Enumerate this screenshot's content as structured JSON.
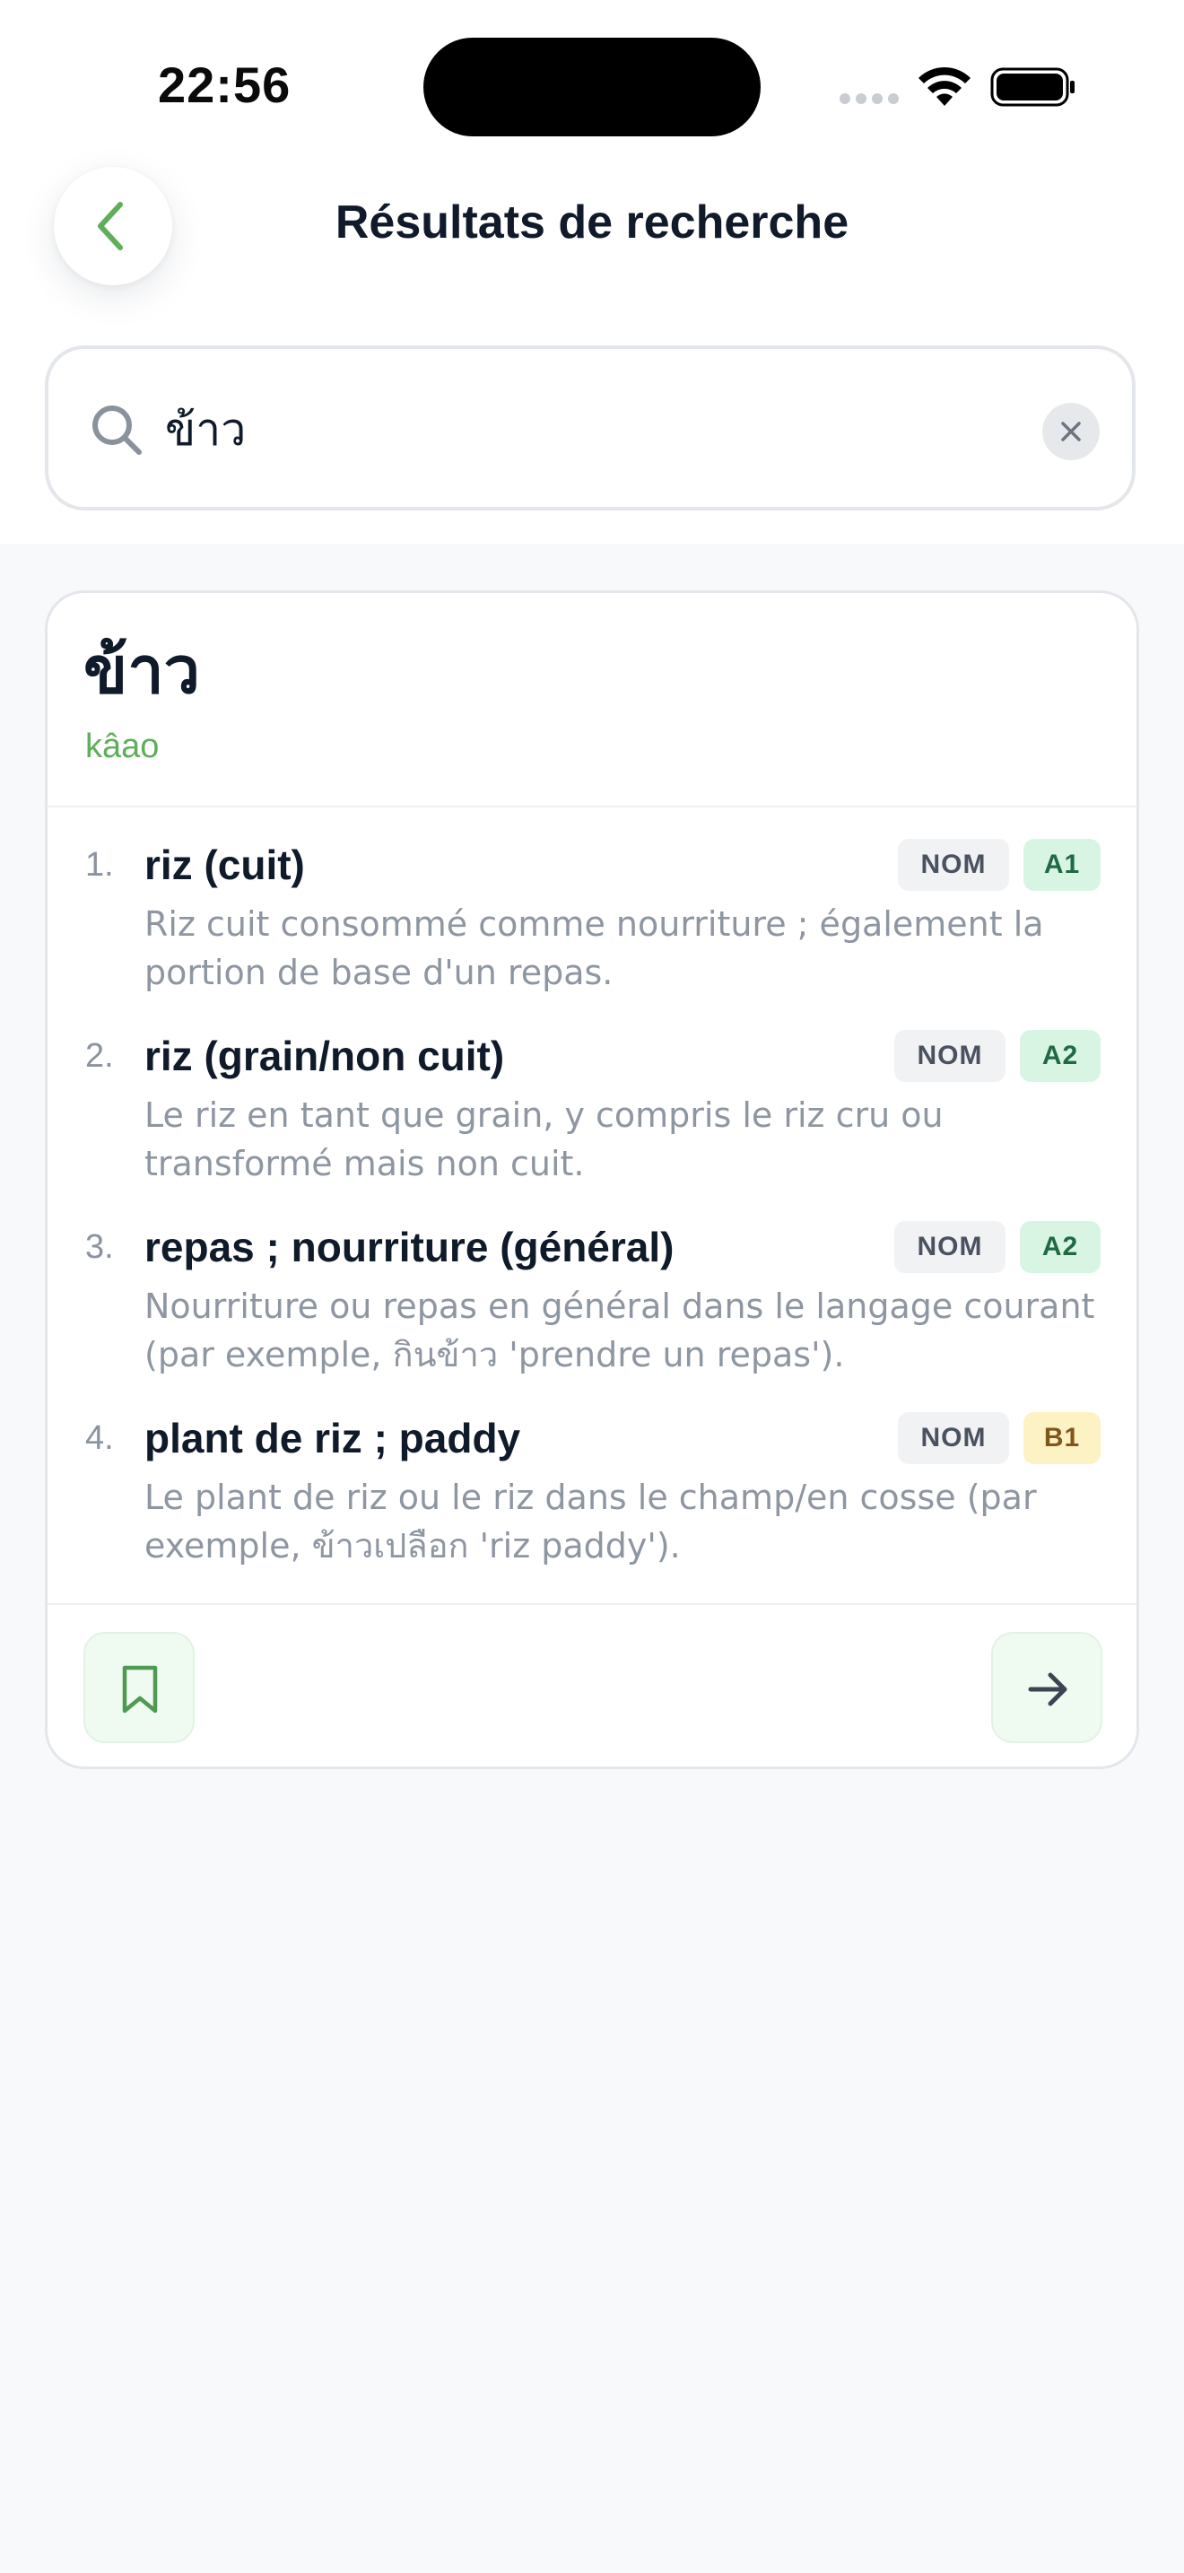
{
  "status_bar": {
    "time": "22:56"
  },
  "header": {
    "title": "Résultats de recherche"
  },
  "search": {
    "value": "ข้าว",
    "placeholder": ""
  },
  "entry": {
    "headword": "ข้าว",
    "romanization": "kâao",
    "senses": [
      {
        "number": "1.",
        "title": "riz (cuit)",
        "pos": "NOM",
        "level": "A1",
        "definition": "Riz cuit consommé comme nourriture ; également la portion de base d'un repas."
      },
      {
        "number": "2.",
        "title": "riz (grain/non cuit)",
        "pos": "NOM",
        "level": "A2",
        "definition": "Le riz en tant que grain, y compris le riz cru ou transformé mais non cuit."
      },
      {
        "number": "3.",
        "title": "repas ; nourriture (général)",
        "pos": "NOM",
        "level": "A2",
        "definition": "Nourriture ou repas en général dans le langage courant (par exemple, กินข้าว 'prendre un repas')."
      },
      {
        "number": "4.",
        "title": "plant de riz ; paddy",
        "pos": "NOM",
        "level": "B1",
        "definition": "Le plant de riz ou le riz dans le champ/en cosse (par exemple, ข้าวเปลือก 'riz paddy')."
      }
    ]
  },
  "icons": {
    "back": "chevron-left-icon",
    "search": "search-icon",
    "clear": "close-icon",
    "bookmark": "bookmark-icon",
    "next": "arrow-right-icon"
  },
  "colors": {
    "accent_green": "#5fae5a",
    "level_a_bg": "#d8f5e4",
    "level_b_bg": "#fdf2c4"
  }
}
